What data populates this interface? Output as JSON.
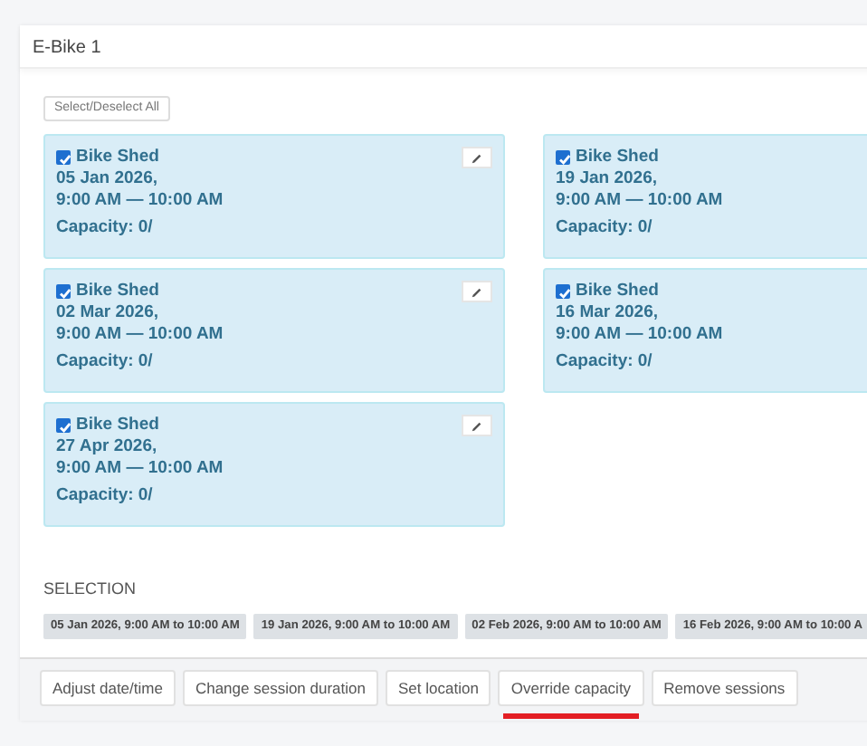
{
  "panel": {
    "title": "E-Bike 1"
  },
  "select_all_button": "Select/Deselect All",
  "sessions": [
    {
      "checked": true,
      "location": "Bike Shed",
      "date": "05 Jan 2026,",
      "time": "9:00 AM — 10:00 AM",
      "capacity": "Capacity: 0/",
      "edit_button": true
    },
    {
      "checked": true,
      "location": "Bike Shed",
      "date": "19 Jan 2026,",
      "time": "9:00 AM — 10:00 AM",
      "capacity": "Capacity: 0/",
      "edit_button": false
    },
    {
      "checked": true,
      "location": "Bike Shed",
      "date": "02 Mar 2026,",
      "time": "9:00 AM — 10:00 AM",
      "capacity": "Capacity: 0/",
      "edit_button": true
    },
    {
      "checked": true,
      "location": "Bike Shed",
      "date": "16 Mar 2026,",
      "time": "9:00 AM — 10:00 AM",
      "capacity": "Capacity: 0/",
      "edit_button": false
    },
    {
      "checked": true,
      "location": "Bike Shed",
      "date": "27 Apr 2026,",
      "time": "9:00 AM — 10:00 AM",
      "capacity": "Capacity: 0/",
      "edit_button": true
    }
  ],
  "selection": {
    "heading": "SELECTION",
    "chips": [
      "05 Jan 2026, 9:00 AM to 10:00 AM",
      "19 Jan 2026, 9:00 AM to 10:00 AM",
      "02 Feb 2026, 9:00 AM to 10:00 AM",
      "16 Feb 2026, 9:00 AM to 10:00 A"
    ]
  },
  "actions": [
    {
      "label": "Adjust date/time",
      "selected": false
    },
    {
      "label": "Change session duration",
      "selected": false
    },
    {
      "label": "Set location",
      "selected": false
    },
    {
      "label": "Override capacity",
      "selected": true
    },
    {
      "label": "Remove sessions",
      "selected": false
    }
  ]
}
